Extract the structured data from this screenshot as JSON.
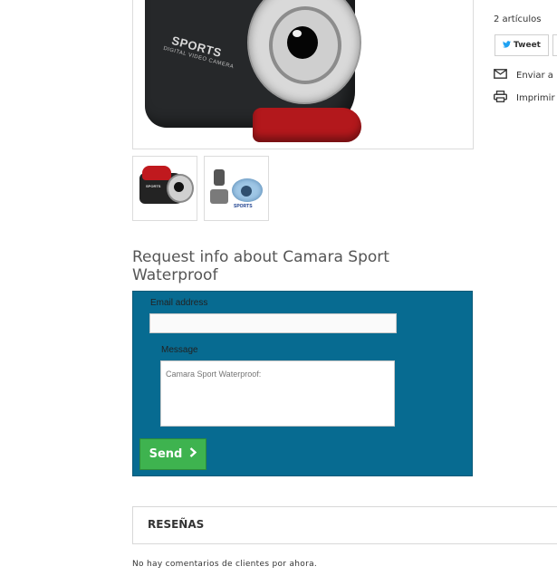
{
  "product": {
    "image_brand_text": "SPORTS",
    "image_sub_text": "DIGITAL VIDEO CAMERA",
    "thumb_brand_text": "SPORTS",
    "thumb2_label": "SPORTS"
  },
  "sidebar": {
    "cart_count": "2 artículos",
    "tweet_label": "Tweet",
    "send_friend_label": "Enviar a",
    "print_label": "Imprimir"
  },
  "request": {
    "title": "Request info about Camara Sport Waterproof",
    "email_label": "Email address",
    "email_value": "",
    "message_label": "Message",
    "message_placeholder": "Camara Sport Waterproof:",
    "send_label": "Send",
    "colors": {
      "form_bg": "#076b91",
      "send_bg": "#3eb34f"
    }
  },
  "reviews": {
    "title": "RESEÑAS",
    "empty_text": "No hay comentarios de clientes por ahora."
  },
  "icons": [
    "twitter-icon",
    "envelope-icon",
    "printer-icon",
    "chevron-right-icon"
  ]
}
